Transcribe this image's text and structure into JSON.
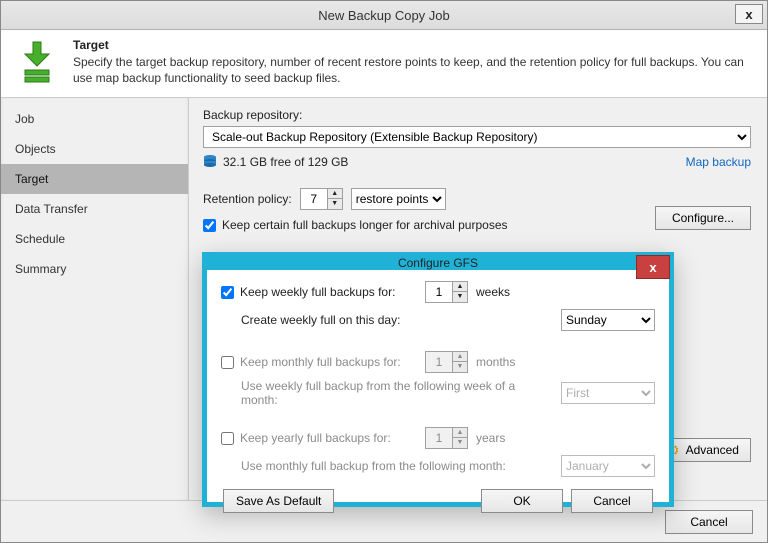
{
  "window": {
    "title": "New Backup Copy Job",
    "close": "x"
  },
  "header": {
    "title": "Target",
    "desc": "Specify the target backup repository, number of recent restore points to keep, and the retention policy for full backups. You can use map backup functionality to seed backup files."
  },
  "sidebar": {
    "items": [
      {
        "label": "Job"
      },
      {
        "label": "Objects"
      },
      {
        "label": "Target"
      },
      {
        "label": "Data Transfer"
      },
      {
        "label": "Schedule"
      },
      {
        "label": "Summary"
      }
    ],
    "active_index": 2
  },
  "content": {
    "repo_label": "Backup repository:",
    "repo_value": "Scale-out Backup Repository (Extensible Backup Repository)",
    "storage_free": "32.1 GB free of 129 GB",
    "map_link": "Map backup",
    "retention_label": "Retention policy:",
    "retention_value": "7",
    "retention_unit": "restore points",
    "keep_full_cb": "Keep certain full backups longer for archival purposes",
    "configure_btn": "Configure...",
    "advanced_btn": "Advanced"
  },
  "footer": {
    "cancel": "Cancel"
  },
  "gfs": {
    "title": "Configure GFS",
    "close": "x",
    "weekly": {
      "checked": true,
      "label": "Keep weekly full backups for:",
      "value": "1",
      "unit": "weeks",
      "sub_label": "Create weekly full on this day:",
      "day": "Sunday"
    },
    "monthly": {
      "checked": false,
      "label": "Keep monthly full backups for:",
      "value": "1",
      "unit": "months",
      "sub_label": "Use weekly full backup from the following week of a month:",
      "week": "First"
    },
    "yearly": {
      "checked": false,
      "label": "Keep yearly full backups for:",
      "value": "1",
      "unit": "years",
      "sub_label": "Use monthly full backup from the following month:",
      "month": "January"
    },
    "save_default": "Save As Default",
    "ok": "OK",
    "cancel": "Cancel"
  }
}
